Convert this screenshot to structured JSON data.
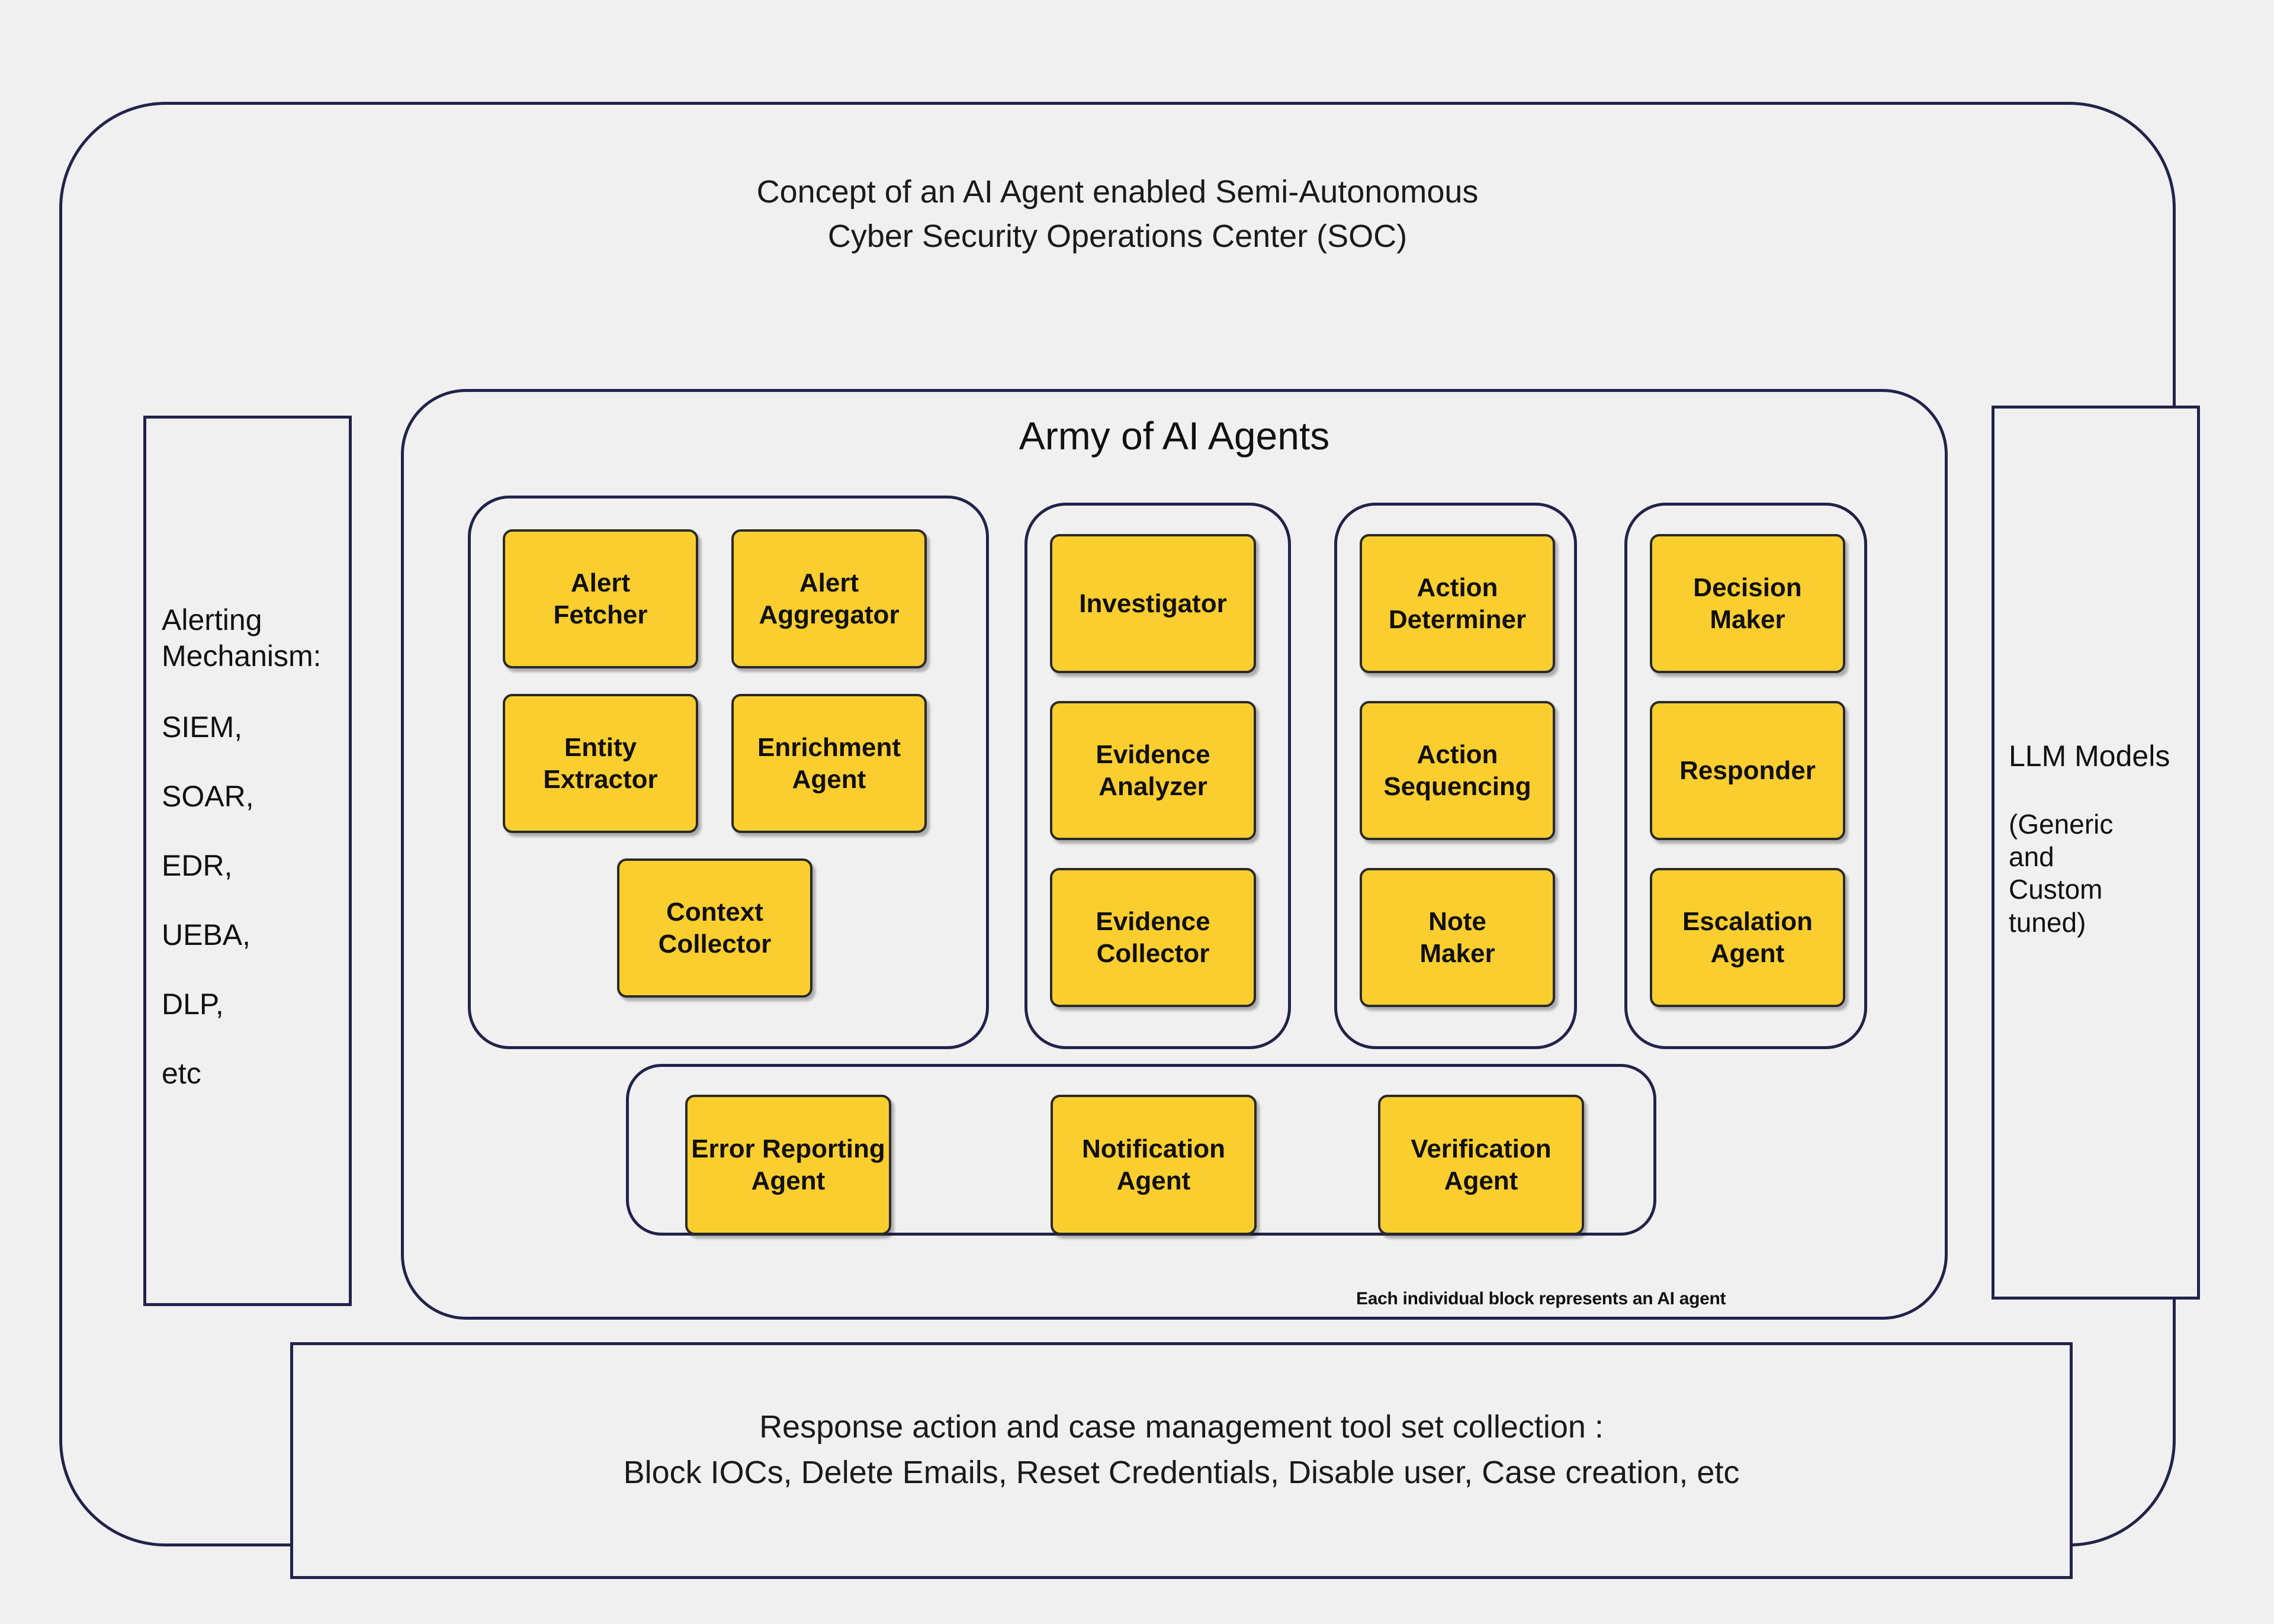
{
  "diagram": {
    "title": "Concept of an AI Agent enabled Semi-Autonomous\nCyber Security Operations Center (SOC)",
    "background_color": "#f0f0f0",
    "border_color": "#22234a",
    "agent_fill_color": "#fbce2f",
    "agent_border_color": "#2a2a2a"
  },
  "alerting": {
    "heading": "Alerting\nMechanism:",
    "items": [
      "SIEM,",
      "SOAR,",
      "EDR,",
      "UEBA,",
      "DLP,",
      "etc"
    ]
  },
  "llm": {
    "heading": "LLM Models",
    "subtext": "(Generic\n and\n Custom\ntuned)"
  },
  "army": {
    "title": "Army of AI Agents",
    "caption": "Each individual block represents an AI agent",
    "groups": [
      {
        "id": "intake",
        "agents": [
          "Alert\nFetcher",
          "Alert\nAggregator",
          "Entity\nExtractor",
          "Enrichment\nAgent",
          "Context\nCollector"
        ]
      },
      {
        "id": "investigate",
        "agents": [
          "Investigator",
          "Evidence\nAnalyzer",
          "Evidence\nCollector"
        ]
      },
      {
        "id": "action",
        "agents": [
          "Action\nDeterminer",
          "Action\nSequencing",
          "Note\nMaker"
        ]
      },
      {
        "id": "decision",
        "agents": [
          "Decision\nMaker",
          "Responder",
          "Escalation\nAgent"
        ]
      },
      {
        "id": "support",
        "agents": [
          "Error Reporting\nAgent",
          "Notification\nAgent",
          "Verification\nAgent"
        ]
      }
    ]
  },
  "tools": {
    "text": "Response action and case management tool set collection :\nBlock IOCs, Delete Emails, Reset Credentials, Disable user, Case creation, etc"
  }
}
